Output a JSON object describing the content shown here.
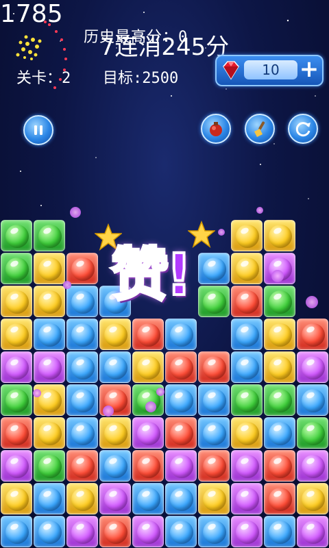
{
  "hud": {
    "high_score": "历史最高分：0",
    "level": "关卡：2",
    "target": "目标:2500",
    "score": "1785",
    "combo": "7连消245分",
    "gem_count": "10",
    "praise": "赞!"
  },
  "icons": {
    "pause": "pause-icon",
    "bomb": "bomb-icon",
    "brush": "brush-icon",
    "refresh": "refresh-icon",
    "gem": "ruby-gem-icon",
    "plus": "plus-icon"
  },
  "board": {
    "colors": {
      "G": "#3ecf3a",
      "Y": "#ffcc1f",
      "B": "#3aa7ff",
      "R": "#ff4b35",
      "P": "#d158ff"
    },
    "rows": [
      "GG-----YY",
      "GYR---BYP",
      "YYBB--GRG",
      "YBBYRB-BYR",
      "PPBBYRRBYP",
      "GYBRGBBGGB",
      "RYBYPRBYBG",
      "PGRBRPRPRP",
      "YBYPBBYPRY",
      "BBPRPBBPBP"
    ]
  }
}
